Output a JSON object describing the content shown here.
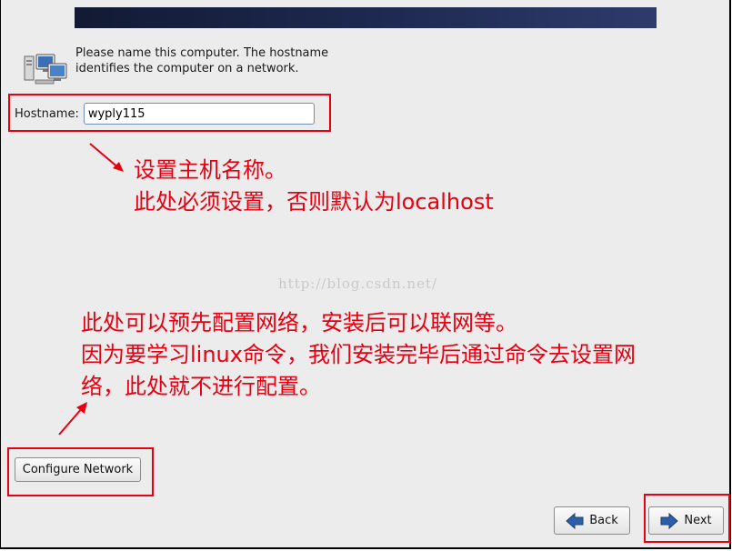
{
  "intro": {
    "message": "Please name this computer.  The hostname identifies the computer on a network.",
    "icon": "network-computers-icon"
  },
  "hostname": {
    "label": "Hostname:",
    "value": "wyply115"
  },
  "annotations": {
    "hostname_note": "设置主机名称。\n此处必须设置，否则默认为localhost",
    "network_note": "此处可以预先配置网络，安装后可以联网等。\n因为要学习linux命令，我们安装完毕后通过命令去设置网\n络，此处就不进行配置。",
    "color": "#e60012"
  },
  "watermark": "http://blog.csdn.net/",
  "buttons": {
    "configure_network": "Configure Network",
    "back": "Back",
    "next": "Next"
  },
  "colors": {
    "banner": "#1e2a52",
    "background": "#ececec",
    "accent_blue": "#2b5fa8"
  }
}
